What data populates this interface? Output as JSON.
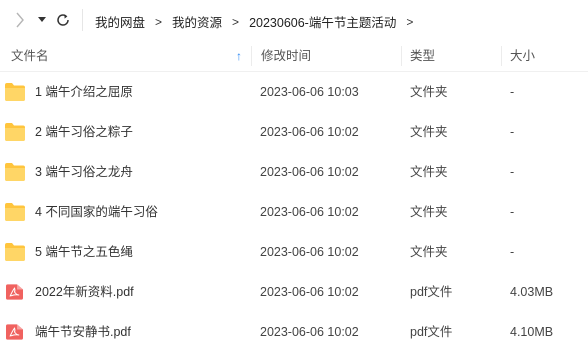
{
  "toolbar": {
    "forward_icon": "chevron-right-icon",
    "dropdown_icon": "caret-down-icon",
    "refresh_icon": "refresh-icon"
  },
  "breadcrumb": {
    "items": [
      "我的网盘",
      "我的资源",
      "20230606-端午节主题活动"
    ],
    "separator": ">"
  },
  "columns": {
    "name": "文件名",
    "date": "修改时间",
    "type": "类型",
    "size": "大小",
    "sort_indicator": "↑"
  },
  "files": [
    {
      "name": "1 端午介绍之屈原",
      "date": "2023-06-06 10:03",
      "type": "文件夹",
      "size": "-",
      "icon": "folder-icon"
    },
    {
      "name": "2 端午习俗之粽子",
      "date": "2023-06-06 10:02",
      "type": "文件夹",
      "size": "-",
      "icon": "folder-icon"
    },
    {
      "name": "3 端午习俗之龙舟",
      "date": "2023-06-06 10:02",
      "type": "文件夹",
      "size": "-",
      "icon": "folder-icon"
    },
    {
      "name": "4 不同国家的端午习俗",
      "date": "2023-06-06 10:02",
      "type": "文件夹",
      "size": "-",
      "icon": "folder-icon"
    },
    {
      "name": "5 端午节之五色绳",
      "date": "2023-06-06 10:02",
      "type": "文件夹",
      "size": "-",
      "icon": "folder-icon"
    },
    {
      "name": "2022年新资料.pdf",
      "date": "2023-06-06 10:02",
      "type": "pdf文件",
      "size": "4.03MB",
      "icon": "pdf-icon"
    },
    {
      "name": "端午节安静书.pdf",
      "date": "2023-06-06 10:02",
      "type": "pdf文件",
      "size": "4.10MB",
      "icon": "pdf-icon"
    }
  ],
  "colors": {
    "folder": "#FFC53D",
    "pdf": "#F0625F",
    "accent": "#2F8AF5"
  }
}
